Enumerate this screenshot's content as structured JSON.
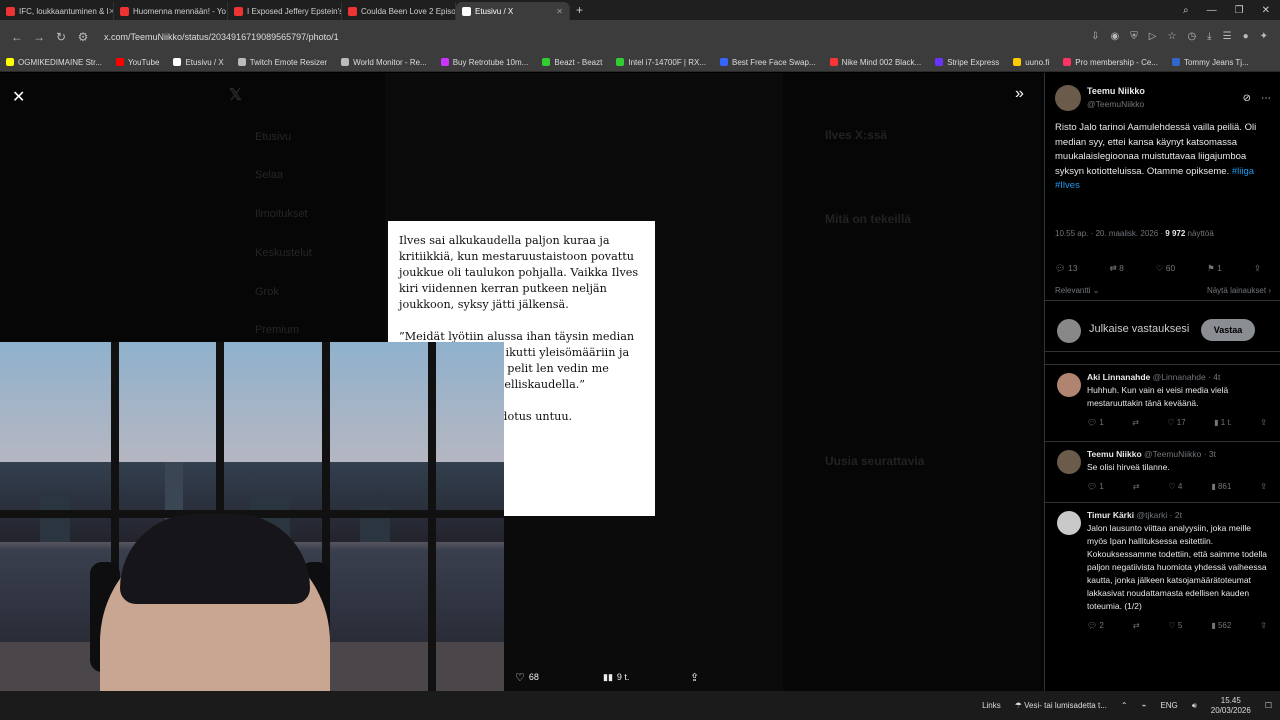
{
  "tabs": [
    {
      "title": "IFC, loukkaantuminen & l",
      "color": "#e33"
    },
    {
      "title": "Huomenna mennään! - Yo",
      "color": "#e33"
    },
    {
      "title": "I Exposed Jeffery Epstein's",
      "color": "#e33"
    },
    {
      "title": "Coulda Been Love 2 Episo",
      "color": "#e33"
    },
    {
      "title": "Etusivu / X",
      "color": "#fff",
      "active": true
    }
  ],
  "address": {
    "url": "x.com/TeemuNiikko/status/2034916719089565797/photo/1"
  },
  "bookmarks": [
    {
      "label": "OGMIKEDIMAINE Str...",
      "color": "#ff0"
    },
    {
      "label": "YouTube",
      "color": "#f00"
    },
    {
      "label": "Etusivu / X",
      "color": "#fff"
    },
    {
      "label": "Twitch Emote Resizer",
      "color": "#bbb"
    },
    {
      "label": "World Monitor - Re...",
      "color": "#bbb"
    },
    {
      "label": "Buy Retrotube 10m...",
      "color": "#c3f"
    },
    {
      "label": "Beazt - Beazt",
      "color": "#3c3"
    },
    {
      "label": "Intel i7-14700F | RX...",
      "color": "#3c3"
    },
    {
      "label": "Best Free Face Swap...",
      "color": "#36f"
    },
    {
      "label": "Nike Mind 002 Black...",
      "color": "#f33"
    },
    {
      "label": "Stripe Express",
      "color": "#63f"
    },
    {
      "label": "uuno.fi",
      "color": "#fc0"
    },
    {
      "label": "Pro membership - Ce...",
      "color": "#f36"
    },
    {
      "label": "Tommy Jeans Tj...",
      "color": "#36c"
    }
  ],
  "dim_nav": [
    "Etusivu",
    "Selaa",
    "Ilmoitukset",
    "Keskustelut",
    "Grok",
    "Premium"
  ],
  "dim_right": {
    "heading": "Ilves X:ssä",
    "trends_heading": "Mitä on tekeillä",
    "follow_heading": "Uusia seurattavia"
  },
  "article": {
    "para1": "Ilves sai alkukaudella paljon kuraa ja kritiikkiä, kun mestaruustaistoon povattu joukkue oli taulukon pohjalla. Vaikka Ilves kiri viidennen kerran putkeen neljän joukkoon, syksy jätti jälkensä.",
    "para2": "”Meidät lyötiin alussa ihan täysin median ti osaan ihmisistä. ikutti yleisömääriin ja ihen. Ensimmäiset pelit len vedin me yleisöä aika uin edelliskaudella.”",
    "para3": "li 800 katsojan pudotus untuu.",
    "para4": "s.”"
  },
  "photo_actions": {
    "likes": "68",
    "views": "9 t."
  },
  "tweet": {
    "name": "Teemu Niikko",
    "handle": "@TeemuNiikko",
    "text": "Risto Jalo tarinoi Aamulehdessä vailla peiliä. Oli median syy, ettei kansa käynyt katsomassa muukalaislegioonaa muistuttavaa liigajumboa syksyn kotiotteluissa. Otamme opikseme.",
    "hashtags": "#liiga #Ilves",
    "meta_time": "10.55 ap. · 20. maalisk. 2026 · ",
    "meta_views": "9 972",
    "meta_views_label": " näyttöä",
    "replies": "13",
    "retweets": "8",
    "likes": "60",
    "bookmarks": "1",
    "sort_label": "Relevantti",
    "show_replies": "Näytä lainaukset"
  },
  "compose": {
    "placeholder": "Julkaise vastauksesi",
    "button": "Vastaa"
  },
  "replies": [
    {
      "name": "Aki Linnanahde",
      "handle": "@Linnanahde · 4t",
      "text": "Huhhuh. Kun vain ei veisi media vielä mestaruuttakin tänä keväänä.",
      "r": "1",
      "rt": "",
      "l": "17",
      "v": "1 t."
    },
    {
      "name": "Teemu Niikko",
      "handle": "@TeemuNiikko · 3t",
      "text": "Se olisi hirveä tilanne.",
      "r": "1",
      "rt": "",
      "l": "4",
      "v": "861"
    },
    {
      "name": "Timur Kärki",
      "handle": "@tjkarki · 2t",
      "text": "Jalon lausunto viittaa analyysiin, joka meille myös Ipan hallituksessa esitettiin. Kokouksessamme todettiin, että saimme todella paljon negatiivista huomiota yhdessä vaiheessa kautta, jonka jälkeen katsojamäärätoteumat lakkasivat noudattamasta edellisen kauden toteumia. (1/2)",
      "r": "2",
      "rt": "",
      "l": "5",
      "v": "562"
    }
  ],
  "taskbar": {
    "links": "Links",
    "weather": "Vesi- tai lumisadetta t...",
    "lang": "ENG",
    "time": "15.45",
    "date": "20/03/2026"
  }
}
